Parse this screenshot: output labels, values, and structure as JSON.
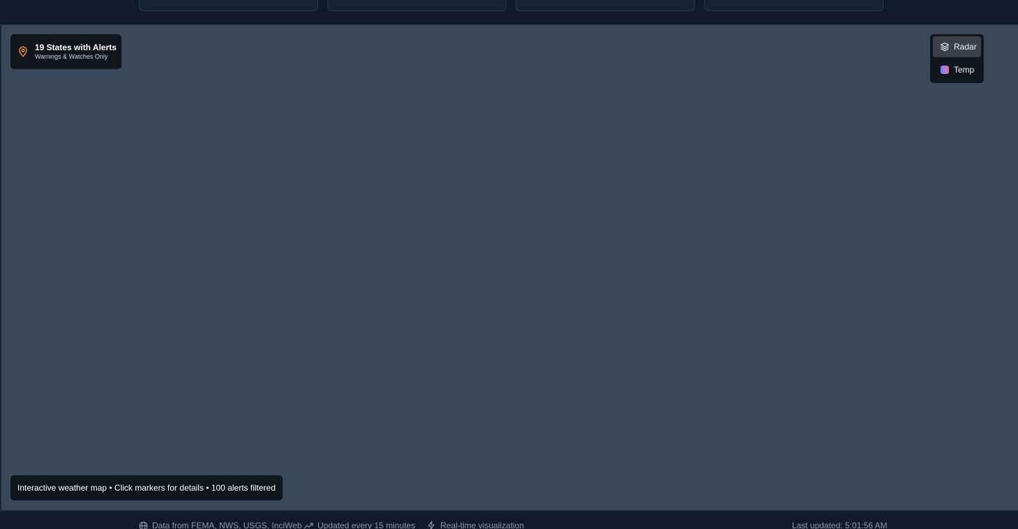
{
  "map": {
    "alert_badge": {
      "title": "19 States with Alerts",
      "subtitle": "Warnings & Watches Only",
      "icon": "map-pin-icon",
      "icon_color": "#f08a24"
    },
    "layers": [
      {
        "label": "Radar",
        "icon": "layers-icon",
        "active": true
      },
      {
        "label": "Temp",
        "icon": "temp-gradient-swatch",
        "active": false
      }
    ],
    "info_text": "Interactive weather map • Click markers for details • 100 alerts filtered",
    "background_color": "#394959"
  },
  "footer": {
    "sources": "Data from FEMA, NWS, USGS, InciWeb",
    "update_frequency": "Updated every 15 minutes",
    "mode": "Real-time visualization",
    "last_updated": "Last updated: 5:01:56 AM"
  }
}
